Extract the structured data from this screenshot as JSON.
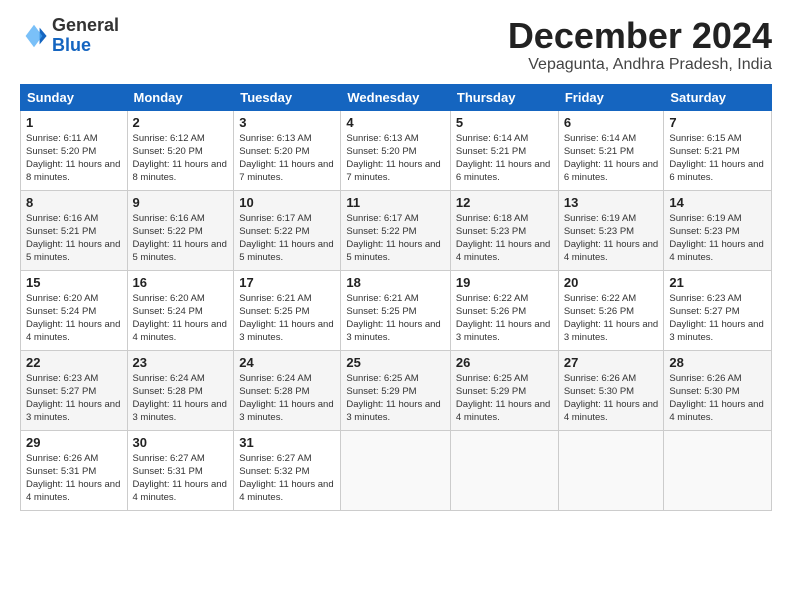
{
  "logo": {
    "general": "General",
    "blue": "Blue"
  },
  "title": "December 2024",
  "location": "Vepagunta, Andhra Pradesh, India",
  "days_of_week": [
    "Sunday",
    "Monday",
    "Tuesday",
    "Wednesday",
    "Thursday",
    "Friday",
    "Saturday"
  ],
  "weeks": [
    [
      {
        "day": "1",
        "sunrise": "6:11 AM",
        "sunset": "5:20 PM",
        "daylight": "11 hours and 8 minutes."
      },
      {
        "day": "2",
        "sunrise": "6:12 AM",
        "sunset": "5:20 PM",
        "daylight": "11 hours and 8 minutes."
      },
      {
        "day": "3",
        "sunrise": "6:13 AM",
        "sunset": "5:20 PM",
        "daylight": "11 hours and 7 minutes."
      },
      {
        "day": "4",
        "sunrise": "6:13 AM",
        "sunset": "5:20 PM",
        "daylight": "11 hours and 7 minutes."
      },
      {
        "day": "5",
        "sunrise": "6:14 AM",
        "sunset": "5:21 PM",
        "daylight": "11 hours and 6 minutes."
      },
      {
        "day": "6",
        "sunrise": "6:14 AM",
        "sunset": "5:21 PM",
        "daylight": "11 hours and 6 minutes."
      },
      {
        "day": "7",
        "sunrise": "6:15 AM",
        "sunset": "5:21 PM",
        "daylight": "11 hours and 6 minutes."
      }
    ],
    [
      {
        "day": "8",
        "sunrise": "6:16 AM",
        "sunset": "5:21 PM",
        "daylight": "11 hours and 5 minutes."
      },
      {
        "day": "9",
        "sunrise": "6:16 AM",
        "sunset": "5:22 PM",
        "daylight": "11 hours and 5 minutes."
      },
      {
        "day": "10",
        "sunrise": "6:17 AM",
        "sunset": "5:22 PM",
        "daylight": "11 hours and 5 minutes."
      },
      {
        "day": "11",
        "sunrise": "6:17 AM",
        "sunset": "5:22 PM",
        "daylight": "11 hours and 5 minutes."
      },
      {
        "day": "12",
        "sunrise": "6:18 AM",
        "sunset": "5:23 PM",
        "daylight": "11 hours and 4 minutes."
      },
      {
        "day": "13",
        "sunrise": "6:19 AM",
        "sunset": "5:23 PM",
        "daylight": "11 hours and 4 minutes."
      },
      {
        "day": "14",
        "sunrise": "6:19 AM",
        "sunset": "5:23 PM",
        "daylight": "11 hours and 4 minutes."
      }
    ],
    [
      {
        "day": "15",
        "sunrise": "6:20 AM",
        "sunset": "5:24 PM",
        "daylight": "11 hours and 4 minutes."
      },
      {
        "day": "16",
        "sunrise": "6:20 AM",
        "sunset": "5:24 PM",
        "daylight": "11 hours and 4 minutes."
      },
      {
        "day": "17",
        "sunrise": "6:21 AM",
        "sunset": "5:25 PM",
        "daylight": "11 hours and 3 minutes."
      },
      {
        "day": "18",
        "sunrise": "6:21 AM",
        "sunset": "5:25 PM",
        "daylight": "11 hours and 3 minutes."
      },
      {
        "day": "19",
        "sunrise": "6:22 AM",
        "sunset": "5:26 PM",
        "daylight": "11 hours and 3 minutes."
      },
      {
        "day": "20",
        "sunrise": "6:22 AM",
        "sunset": "5:26 PM",
        "daylight": "11 hours and 3 minutes."
      },
      {
        "day": "21",
        "sunrise": "6:23 AM",
        "sunset": "5:27 PM",
        "daylight": "11 hours and 3 minutes."
      }
    ],
    [
      {
        "day": "22",
        "sunrise": "6:23 AM",
        "sunset": "5:27 PM",
        "daylight": "11 hours and 3 minutes."
      },
      {
        "day": "23",
        "sunrise": "6:24 AM",
        "sunset": "5:28 PM",
        "daylight": "11 hours and 3 minutes."
      },
      {
        "day": "24",
        "sunrise": "6:24 AM",
        "sunset": "5:28 PM",
        "daylight": "11 hours and 3 minutes."
      },
      {
        "day": "25",
        "sunrise": "6:25 AM",
        "sunset": "5:29 PM",
        "daylight": "11 hours and 3 minutes."
      },
      {
        "day": "26",
        "sunrise": "6:25 AM",
        "sunset": "5:29 PM",
        "daylight": "11 hours and 4 minutes."
      },
      {
        "day": "27",
        "sunrise": "6:26 AM",
        "sunset": "5:30 PM",
        "daylight": "11 hours and 4 minutes."
      },
      {
        "day": "28",
        "sunrise": "6:26 AM",
        "sunset": "5:30 PM",
        "daylight": "11 hours and 4 minutes."
      }
    ],
    [
      {
        "day": "29",
        "sunrise": "6:26 AM",
        "sunset": "5:31 PM",
        "daylight": "11 hours and 4 minutes."
      },
      {
        "day": "30",
        "sunrise": "6:27 AM",
        "sunset": "5:31 PM",
        "daylight": "11 hours and 4 minutes."
      },
      {
        "day": "31",
        "sunrise": "6:27 AM",
        "sunset": "5:32 PM",
        "daylight": "11 hours and 4 minutes."
      },
      null,
      null,
      null,
      null
    ]
  ]
}
